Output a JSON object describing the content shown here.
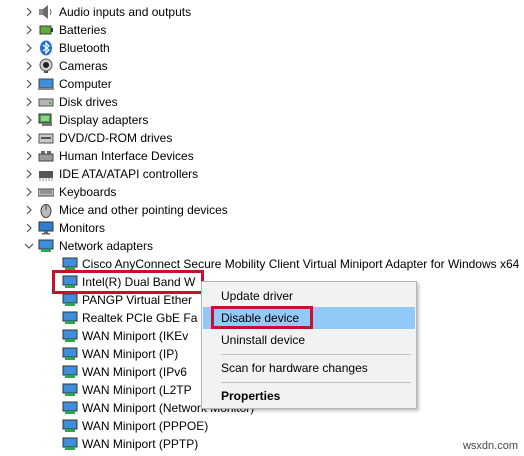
{
  "tree": {
    "categories": [
      {
        "label": "Audio inputs and outputs",
        "icon": "speaker-icon",
        "expanded": false
      },
      {
        "label": "Batteries",
        "icon": "battery-icon",
        "expanded": false
      },
      {
        "label": "Bluetooth",
        "icon": "bluetooth-icon",
        "expanded": false
      },
      {
        "label": "Cameras",
        "icon": "camera-icon",
        "expanded": false
      },
      {
        "label": "Computer",
        "icon": "computer-icon",
        "expanded": false
      },
      {
        "label": "Disk drives",
        "icon": "disk-drive-icon",
        "expanded": false
      },
      {
        "label": "Display adapters",
        "icon": "display-adapter-icon",
        "expanded": false
      },
      {
        "label": "DVD/CD-ROM drives",
        "icon": "dvd-drive-icon",
        "expanded": false
      },
      {
        "label": "Human Interface Devices",
        "icon": "hid-icon",
        "expanded": false
      },
      {
        "label": "IDE ATA/ATAPI controllers",
        "icon": "ide-controller-icon",
        "expanded": false
      },
      {
        "label": "Keyboards",
        "icon": "keyboard-icon",
        "expanded": false
      },
      {
        "label": "Mice and other pointing devices",
        "icon": "mouse-icon",
        "expanded": false
      },
      {
        "label": "Monitors",
        "icon": "monitor-icon",
        "expanded": false
      },
      {
        "label": "Network adapters",
        "icon": "network-adapter-icon",
        "expanded": true
      }
    ],
    "network_children": [
      "Cisco AnyConnect Secure Mobility Client Virtual Miniport Adapter for Windows x64",
      "Intel(R) Dual Band W",
      "PANGP Virtual Ether",
      "Realtek PCIe GbE Fa",
      "WAN Miniport (IKEv",
      "WAN Miniport (IP)",
      "WAN Miniport (IPv6",
      "WAN Miniport (L2TP",
      "WAN Miniport (Network Monitor)",
      "WAN Miniport (PPPOE)",
      "WAN Miniport (PPTP)"
    ]
  },
  "context_menu": {
    "update_driver": "Update driver",
    "disable_device": "Disable device",
    "uninstall_device": "Uninstall device",
    "scan_hardware": "Scan for hardware changes",
    "properties": "Properties"
  },
  "watermark": "wsxdn.com",
  "colors": {
    "highlight_border": "#c8102e",
    "menu_hover": "#91c9f7",
    "menu_bg": "#f2f2f2"
  }
}
